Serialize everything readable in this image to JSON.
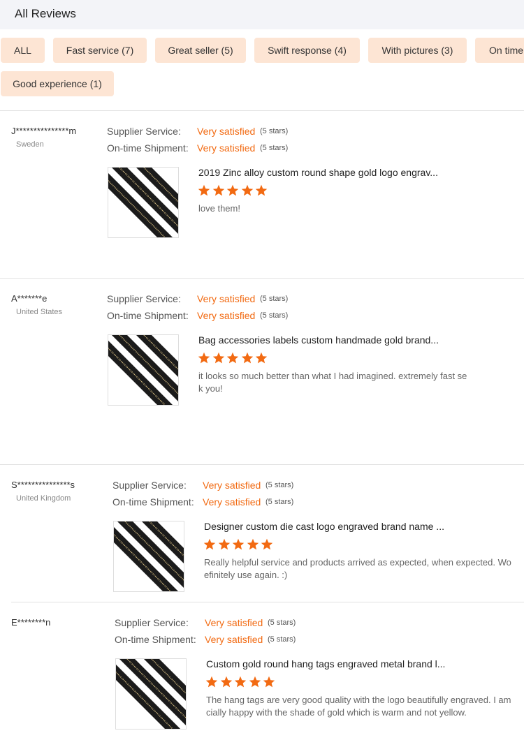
{
  "header": {
    "title": "All Reviews"
  },
  "filters": [
    {
      "label": "ALL"
    },
    {
      "label": "Fast service (7)"
    },
    {
      "label": "Great seller (5)"
    },
    {
      "label": "Swift response (4)"
    },
    {
      "label": "With pictures (3)"
    },
    {
      "label": "On time"
    },
    {
      "label": "Good experience (1)"
    }
  ],
  "labels": {
    "supplier_service": "Supplier Service:",
    "ontime_shipment": "On-time Shipment:"
  },
  "colors": {
    "accent": "#f26a12",
    "chip_bg": "#fde5d4",
    "header_bg": "#f3f4f8"
  },
  "reviews": [
    {
      "name": "J***************m",
      "country": "Sweden",
      "supplier_value": "Very satisfied",
      "supplier_stars": "(5 stars)",
      "shipment_value": "Very satisfied",
      "shipment_stars": "(5 stars)",
      "product_title": "2019 Zinc alloy custom round shape gold logo engrav...",
      "rating": 5,
      "comment_lines": [
        "love them!"
      ],
      "image_icon": "zipper-product-image"
    },
    {
      "name": "A*******e",
      "country": "United States",
      "supplier_value": "Very satisfied",
      "supplier_stars": "(5 stars)",
      "shipment_value": "Very satisfied",
      "shipment_stars": "(5 stars)",
      "product_title": "Bag accessories labels custom handmade gold brand...",
      "rating": 5,
      "comment_lines": [
        "it looks so much better than what I had imagined. extremely fast se",
        "k you!"
      ],
      "image_icon": "zipper-product-image"
    },
    {
      "name": "S***************s",
      "country": "United Kingdom",
      "supplier_value": "Very satisfied",
      "supplier_stars": "(5 stars)",
      "shipment_value": "Very satisfied",
      "shipment_stars": "(5 stars)",
      "product_title": "Designer custom die cast logo engraved brand name ...",
      "rating": 5,
      "comment_lines": [
        "Really helpful service and products arrived as expected, when expected.  Wo",
        "efinitely use again.  :)"
      ],
      "image_icon": "zipper-product-image"
    },
    {
      "name": "E********n",
      "country": "",
      "supplier_value": "Very satisfied",
      "supplier_stars": "(5 stars)",
      "shipment_value": "Very satisfied",
      "shipment_stars": "(5 stars)",
      "product_title": "Custom gold round hang tags engraved metal brand l...",
      "rating": 5,
      "comment_lines": [
        "The hang tags are very good quality with the logo beautifully engraved. I am",
        "cially happy with the shade of gold which is warm and not yellow."
      ],
      "image_icon": "zipper-product-image"
    }
  ]
}
